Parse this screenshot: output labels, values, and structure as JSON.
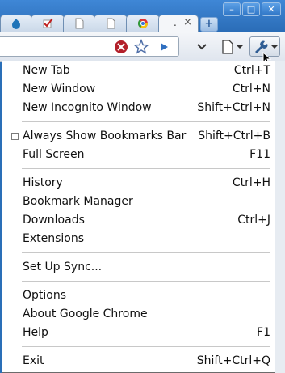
{
  "tabs": [
    {
      "icon": "drupal-icon",
      "active": false
    },
    {
      "icon": "checklist-icon",
      "active": false
    },
    {
      "icon": "page-icon",
      "active": false
    },
    {
      "icon": "page-icon",
      "active": false
    },
    {
      "icon": "chrome-icon",
      "active": false
    },
    {
      "icon": "page-icon",
      "active": true,
      "title": "."
    }
  ],
  "tab_close_glyph": "×",
  "new_tab_glyph": "+",
  "window_controls": {
    "minimize": "–",
    "maximize": "□",
    "close": "✕"
  },
  "toolbar_icons": [
    "stop-icon",
    "star-icon",
    "go-icon",
    "page-menu-icon",
    "wrench-icon"
  ],
  "menu": {
    "groups": [
      [
        {
          "label": "New Tab",
          "accel": "Ctrl+T"
        },
        {
          "label": "New Window",
          "accel": "Ctrl+N"
        },
        {
          "label": "New Incognito Window",
          "accel": "Shift+Ctrl+N"
        }
      ],
      [
        {
          "label": "Always Show Bookmarks Bar",
          "accel": "Shift+Ctrl+B",
          "checkbox": true,
          "checked": false
        },
        {
          "label": "Full Screen",
          "accel": "F11"
        }
      ],
      [
        {
          "label": "History",
          "accel": "Ctrl+H"
        },
        {
          "label": "Bookmark Manager",
          "accel": ""
        },
        {
          "label": "Downloads",
          "accel": "Ctrl+J"
        },
        {
          "label": "Extensions",
          "accel": ""
        }
      ],
      [
        {
          "label": "Set Up Sync...",
          "accel": ""
        }
      ],
      [
        {
          "label": "Options",
          "accel": ""
        },
        {
          "label": "About Google Chrome",
          "accel": ""
        },
        {
          "label": "Help",
          "accel": "F1"
        }
      ],
      [
        {
          "label": "Exit",
          "accel": "Shift+Ctrl+Q"
        }
      ]
    ]
  },
  "colors": {
    "titlebar": "#2a6cb6",
    "menu_bg": "#ffffff",
    "stop_red": "#b3202a",
    "go_blue": "#2f6fc0"
  }
}
